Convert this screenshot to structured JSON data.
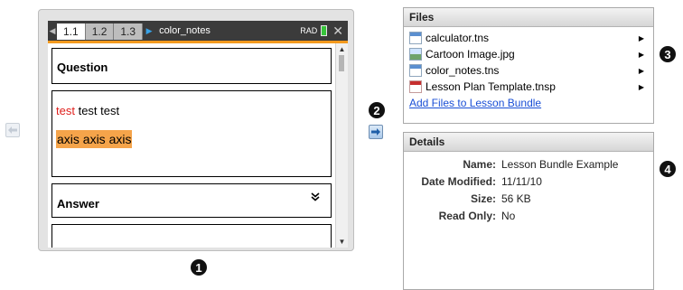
{
  "device": {
    "tabs": [
      "1.1",
      "1.2",
      "1.3"
    ],
    "active_tab": "1.1",
    "document_name": "color_notes",
    "angle_mode": "RAD",
    "question_label": "Question",
    "text_red": "test",
    "text_rest": " test test",
    "highlighted_text": "axis axis axis",
    "answer_label": "Answer",
    "collapse_glyph": "»"
  },
  "callouts": [
    "1",
    "2",
    "3",
    "4"
  ],
  "files": {
    "header": "Files",
    "items": [
      {
        "name": "calculator.tns",
        "icon": "tns-file-icon"
      },
      {
        "name": "Cartoon Image.jpg",
        "icon": "image-file-icon"
      },
      {
        "name": "color_notes.tns",
        "icon": "tns-file-icon"
      },
      {
        "name": "Lesson Plan Template.tnsp",
        "icon": "tnsp-file-icon"
      }
    ],
    "add_link": "Add Files to Lesson Bundle"
  },
  "details": {
    "header": "Details",
    "rows": [
      {
        "key": "Name:",
        "value": "Lesson Bundle Example"
      },
      {
        "key": "Date Modified:",
        "value": "11/11/10"
      },
      {
        "key": "Size:",
        "value": "56 KB"
      },
      {
        "key": "Read Only:",
        "value": "No"
      }
    ]
  },
  "colors": {
    "accent_orange": "#f39a1e",
    "highlight": "#f5a44a",
    "red_text": "#e0201d",
    "link_blue": "#1a4fd6",
    "battery_green": "#37c43a"
  }
}
